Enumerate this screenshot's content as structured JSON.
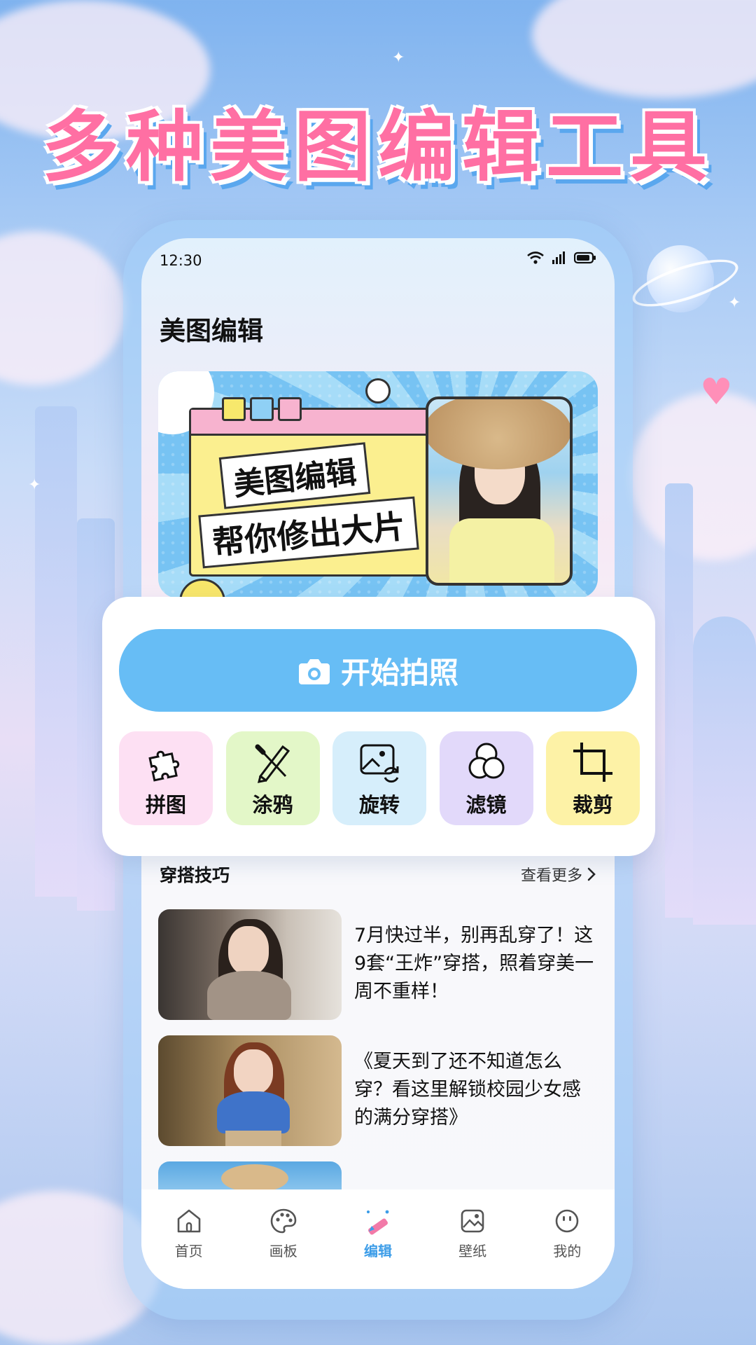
{
  "headline": "多种美图编辑工具",
  "status_bar": {
    "time": "12:30"
  },
  "page": {
    "title": "美图编辑"
  },
  "banner": {
    "line1": "美图编辑",
    "line2": "帮你修出大片"
  },
  "actions": {
    "camera_label": "开始拍照",
    "tools": [
      {
        "label": "拼图",
        "icon": "puzzle-icon",
        "color": "#fde0f3"
      },
      {
        "label": "涂鸦",
        "icon": "brush-pencil-icon",
        "color": "#e3f7c8"
      },
      {
        "label": "旋转",
        "icon": "image-rotate-icon",
        "color": "#d6eefb"
      },
      {
        "label": "滤镜",
        "icon": "filter-circles-icon",
        "color": "#e2d9fa"
      },
      {
        "label": "裁剪",
        "icon": "crop-icon",
        "color": "#fdf2a6"
      }
    ]
  },
  "section": {
    "title": "穿搭技巧",
    "see_more": "查看更多"
  },
  "articles": [
    {
      "title": "7月快过半，别再乱穿了！这9套“王炸”穿搭，照着穿美一周不重样！"
    },
    {
      "title": "《夏天到了还不知道怎么穿？看这里解锁校园少女感的满分穿搭》"
    }
  ],
  "nav": {
    "items": [
      {
        "label": "首页",
        "icon": "home-icon",
        "active": false
      },
      {
        "label": "画板",
        "icon": "palette-icon",
        "active": false
      },
      {
        "label": "编辑",
        "icon": "edit-pencil-icon",
        "active": true
      },
      {
        "label": "壁纸",
        "icon": "wallpaper-icon",
        "active": false
      },
      {
        "label": "我的",
        "icon": "profile-face-icon",
        "active": false
      }
    ]
  },
  "colors": {
    "accent": "#67bdf5",
    "nav_active": "#3d9de8",
    "headline": "#ff6fa3"
  }
}
